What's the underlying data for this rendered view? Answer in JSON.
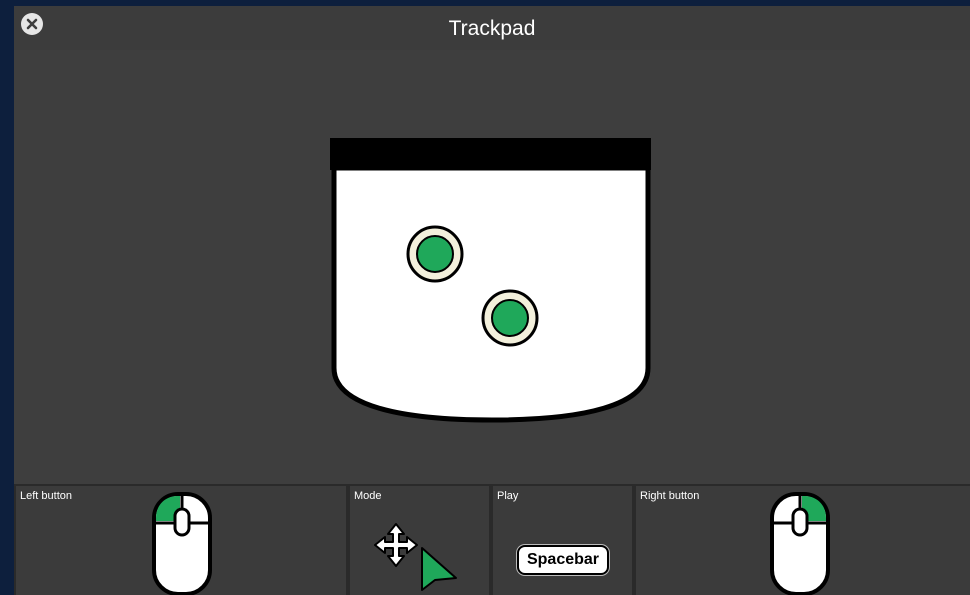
{
  "window": {
    "title": "Trackpad",
    "close_icon": "close-icon"
  },
  "trackpad": {
    "touch_points": 2,
    "accent_color": "#1fa85a",
    "surface_color": "#ffffff",
    "header_color": "#000000"
  },
  "panels": {
    "left_button": {
      "label": "Left button",
      "icon": "mouse-left-click-icon"
    },
    "mode": {
      "label": "Mode",
      "icons": [
        "move-arrows-icon",
        "pointer-cursor-icon"
      ]
    },
    "play": {
      "label": "Play",
      "key_label": "Spacebar"
    },
    "right_button": {
      "label": "Right button",
      "icon": "mouse-right-click-icon"
    }
  },
  "colors": {
    "background": "#3c3c3c",
    "frame": "#0d1f3d",
    "accent": "#1fa85a"
  }
}
